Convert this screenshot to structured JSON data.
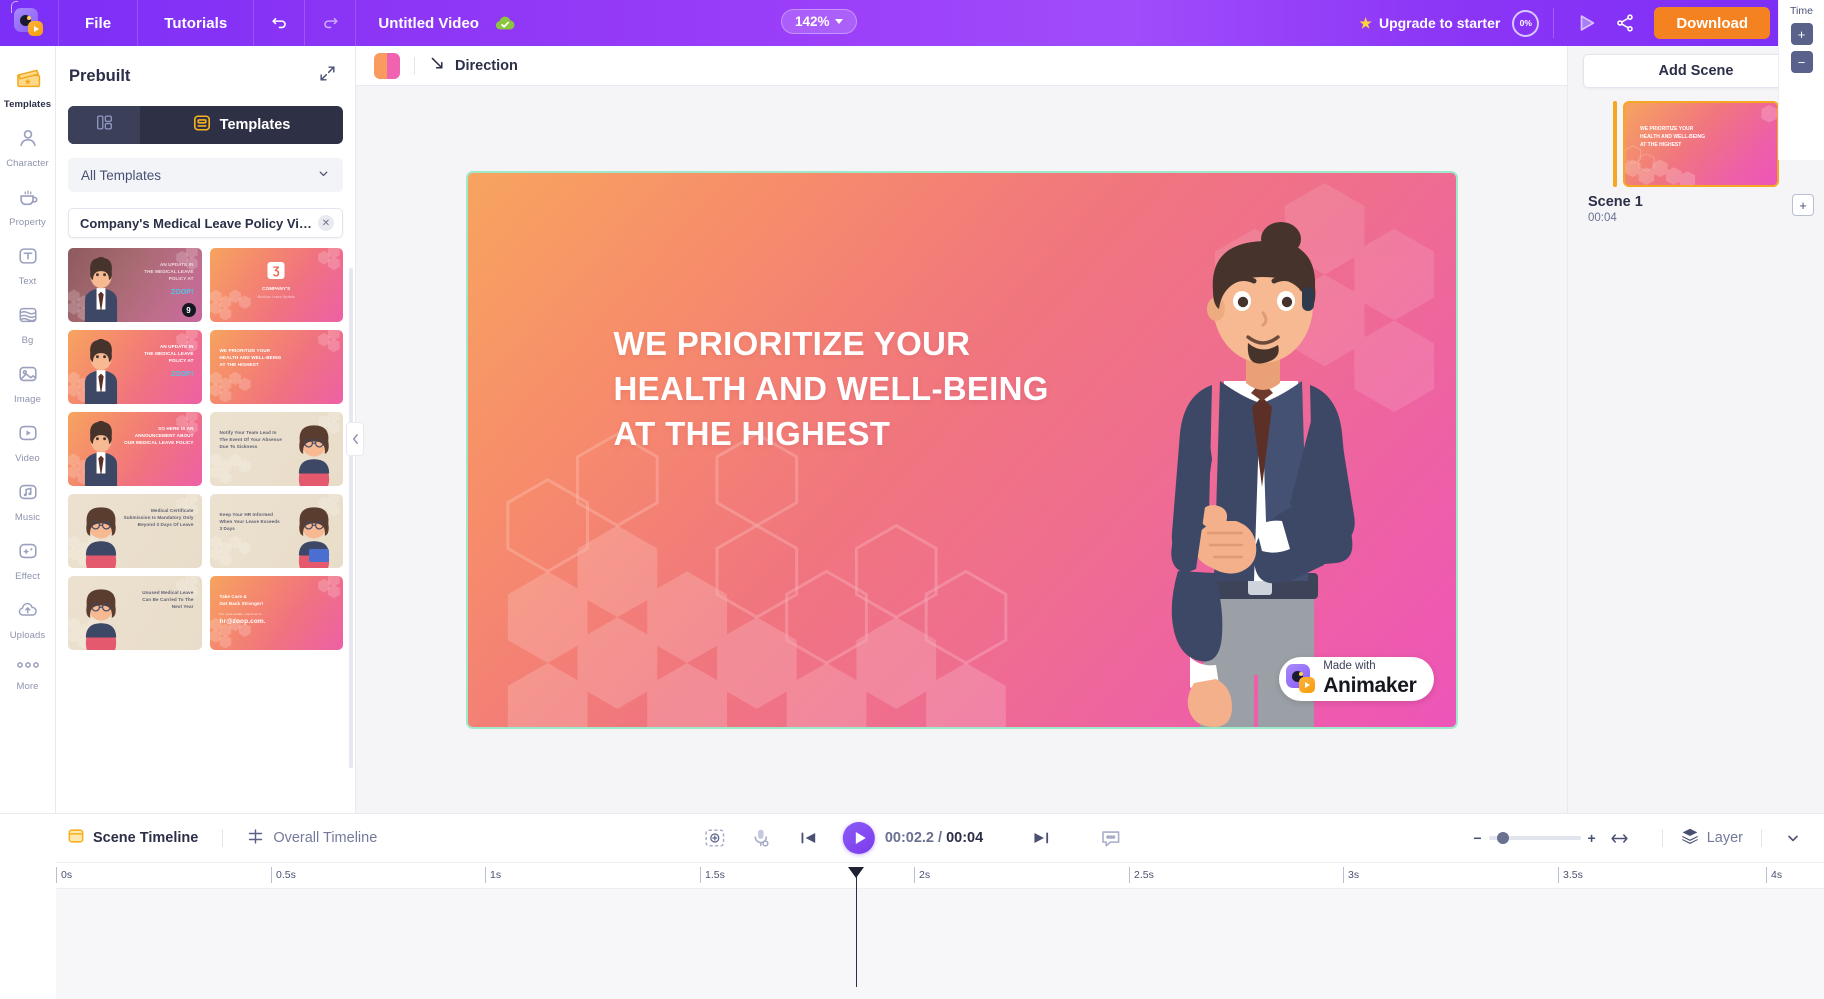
{
  "topbar": {
    "menu": [
      {
        "label": "File"
      },
      {
        "label": "Tutorials"
      }
    ],
    "undo_icon": "undo-icon",
    "redo_icon": "redo-icon",
    "project_title": "Untitled Video",
    "save_status_icon": "cloud-saved-icon",
    "zoom_level": "142%",
    "upgrade_label": "Upgrade to starter",
    "upgrade_percent": "0%",
    "preview_icon": "preview-play-icon",
    "share_icon": "share-icon",
    "download_label": "Download",
    "avatar_icon": "user-avatar"
  },
  "rail": {
    "items": [
      {
        "label": "Templates",
        "icon": "clapperboard-icon",
        "active": true
      },
      {
        "label": "Character",
        "icon": "person-icon",
        "active": false
      },
      {
        "label": "Property",
        "icon": "cup-icon",
        "active": false
      },
      {
        "label": "Text",
        "icon": "text-t-icon",
        "active": false
      },
      {
        "label": "Bg",
        "icon": "layers-bg-icon",
        "active": false
      },
      {
        "label": "Image",
        "icon": "image-icon",
        "active": false
      },
      {
        "label": "Video",
        "icon": "video-play-icon",
        "active": false
      },
      {
        "label": "Music",
        "icon": "music-note-icon",
        "active": false
      },
      {
        "label": "Effect",
        "icon": "sparkle-effect-icon",
        "active": false
      },
      {
        "label": "Uploads",
        "icon": "cloud-upload-icon",
        "active": false
      },
      {
        "label": "More",
        "icon": "ellipsis-icon",
        "active": false
      }
    ]
  },
  "panel": {
    "title": "Prebuilt",
    "expand_icon": "expand-arrows-icon",
    "tab_layout_icon": "layout-grid-icon",
    "tab_templates_label": "Templates",
    "tab_templates_icon": "template-icon",
    "filter_value": "All Templates",
    "filter_caret_icon": "chevron-down-icon",
    "search_chip": "Company's Medical Leave Policy Video Te...",
    "search_chip_clear_icon": "close-icon",
    "templates": [
      {
        "text": "AN UPDATE IN\nTHE MEDICAL LEAVE\nPOLICY AT",
        "accent": "ZOOP!",
        "badge": "9",
        "style": "dark-mauve",
        "align": "right"
      },
      {
        "text": "COMPANY'S",
        "accent": "Medical Leave Update",
        "badge": "",
        "style": "peach-pink",
        "align": "center"
      },
      {
        "text": "AN UPDATE IN\nTHE MEDICAL LEAVE\nPOLICY AT",
        "accent": "ZOOP!",
        "badge": "",
        "style": "peach-pink",
        "align": "right"
      },
      {
        "text": "WE PRIORITIZE YOUR\nHEALTH AND WELL-BEING\nAT THE HIGHEST",
        "accent": "",
        "badge": "",
        "style": "peach-pink",
        "align": "left"
      },
      {
        "text": "SO HERE IS AN\nANNOUNCEMENT ABOUT\nOUR MEDICAL LEAVE POLICY",
        "accent": "",
        "badge": "",
        "style": "peach-pink",
        "align": "right"
      },
      {
        "text": "Notify Your Team Lead In\nThe Event Of Your Absence\nDue To Sickness",
        "accent": "",
        "badge": "",
        "style": "cream",
        "align": "left"
      },
      {
        "text": "Medical Certificate\nSubmission Is Mandatory Only\nBeyond 3 Days Of Leave",
        "accent": "",
        "badge": "",
        "style": "cream",
        "align": "right"
      },
      {
        "text": "Keep Your HR Informed\nWhen Your Leave Exceeds\n3 Days",
        "accent": "",
        "badge": "",
        "style": "cream",
        "align": "left"
      },
      {
        "text": "Unused Medical Leave\nCan Be Carried To The\nNext Year",
        "accent": "",
        "badge": "",
        "style": "cream",
        "align": "right"
      },
      {
        "text": "Take Care &\nGet Back Stronger!",
        "accent": "hr@zoop.com.",
        "sub": "For more details, reach out to",
        "badge": "",
        "style": "peach-pink",
        "align": "left"
      }
    ],
    "collapse_icon": "chevron-left-icon"
  },
  "canvas_toolbar": {
    "color_swatch_name": "color-swatch",
    "direction_label": "Direction",
    "direction_icon": "diagonal-arrow-icon",
    "fit_icon": "fit-screen-icon"
  },
  "canvas": {
    "heading_line1": "WE PRIORITIZE YOUR",
    "heading_line2": "HEALTH AND WELL-BEING",
    "heading_line3": "AT THE HIGHEST",
    "watermark_small": "Made with",
    "watermark_brand": "Animaker",
    "gradient_from": "#f7a45f",
    "gradient_to": "#ed55b8",
    "selection_color": "#9fe8c9"
  },
  "scenes": {
    "add_scene_label": "Add Scene",
    "items": [
      {
        "name": "Scene 1",
        "duration": "00:04",
        "thumb_line1": "WE PRIORITIZE YOUR",
        "thumb_line2": "HEALTH AND WELL-BEING",
        "thumb_line3": "AT THE HIGHEST",
        "active_color": "#f5a623"
      }
    ],
    "add_after_icon": "plus-icon"
  },
  "timeline": {
    "tab_scene_label": "Scene Timeline",
    "tab_scene_icon": "scene-timeline-icon",
    "tab_overall_label": "Overall Timeline",
    "tab_overall_icon": "overall-timeline-icon",
    "controls": {
      "camera_icon": "camera-add-icon",
      "mic_icon": "microphone-icon",
      "prev_icon": "skip-previous-icon",
      "play_icon": "play-icon",
      "next_icon": "skip-next-icon",
      "caption_icon": "caption-icon"
    },
    "current_time": "00:02.2",
    "separator": "/",
    "total_time": "00:04",
    "zoom_minus": "−",
    "zoom_plus": "+",
    "fit_icon": "fit-width-icon",
    "layer_label": "Layer",
    "layer_icon": "layers-icon",
    "chevron_icon": "chevron-down-icon",
    "ruler_ticks": [
      "0s",
      "0.5s",
      "1s",
      "1.5s",
      "2s",
      "2.5s",
      "3s",
      "3.5s",
      "4s"
    ],
    "time_col_label": "Time",
    "time_plus": "+",
    "time_minus": "−",
    "playhead_time": "2.2s"
  }
}
